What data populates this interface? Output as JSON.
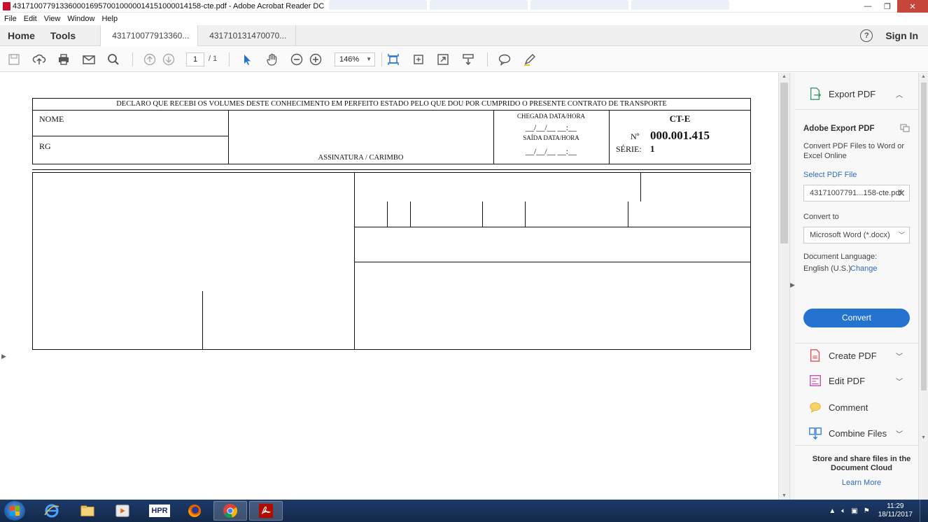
{
  "window": {
    "title": "43171007791336000169570010000014151000014158-cte.pdf - Adobe Acrobat Reader DC",
    "minimize": "—",
    "maximize": "❐",
    "close": "✕"
  },
  "menu": [
    "File",
    "Edit",
    "View",
    "Window",
    "Help"
  ],
  "tabs": {
    "home": "Home",
    "tools": "Tools",
    "docs": [
      "431710077913360...",
      "431710131470070..."
    ],
    "help": "?",
    "signin": "Sign In"
  },
  "toolbar": {
    "page_current": "1",
    "page_total": "/ 1",
    "zoom": "146%"
  },
  "pdf": {
    "declaration": "DECLARO QUE RECEBI OS VOLUMES DESTE CONHECIMENTO EM PERFEITO ESTADO PELO QUE DOU POR CUMPRIDO O PRESENTE CONTRATO DE TRANSPORTE",
    "nome": "NOME",
    "rg": "RG",
    "assinatura": "ASSINATURA / CARIMBO",
    "chegada": "CHEGADA DATA/HORA",
    "chegada_fields": "__/__/__   __:__",
    "saida": "SAÍDA DATA/HORA",
    "saida_fields": "__/__/__   __:__",
    "cte_label": "CT-E",
    "numero_label": "Nº",
    "numero_value": "000.001.415",
    "serie_label": "SÉRIE:",
    "serie_value": "1"
  },
  "panel": {
    "export_pdf": "Export PDF",
    "adobe_export_pdf": "Adobe Export PDF",
    "description": "Convert PDF Files to Word or Excel Online",
    "select_pdf_file": "Select PDF File",
    "selected_file": "43171007791...158-cte.pdf",
    "convert_to": "Convert to",
    "convert_target": "Microsoft Word (*.docx)",
    "document_language": "Document Language:",
    "language_value": "English (U.S.)",
    "change": "Change",
    "convert_button": "Convert",
    "tools": [
      "Create PDF",
      "Edit PDF",
      "Comment",
      "Combine Files"
    ],
    "cloud_text": "Store and share files in the Document Cloud",
    "learn_more": "Learn More"
  },
  "taskbar": {
    "hpr_label": "HPR",
    "time": "11:29",
    "date": "18/11/2017"
  },
  "colors": {
    "accent": "#2473d1",
    "link": "#2d6cc0",
    "acrobat_red": "#c8102e",
    "taskbar": "#1c3a68"
  }
}
